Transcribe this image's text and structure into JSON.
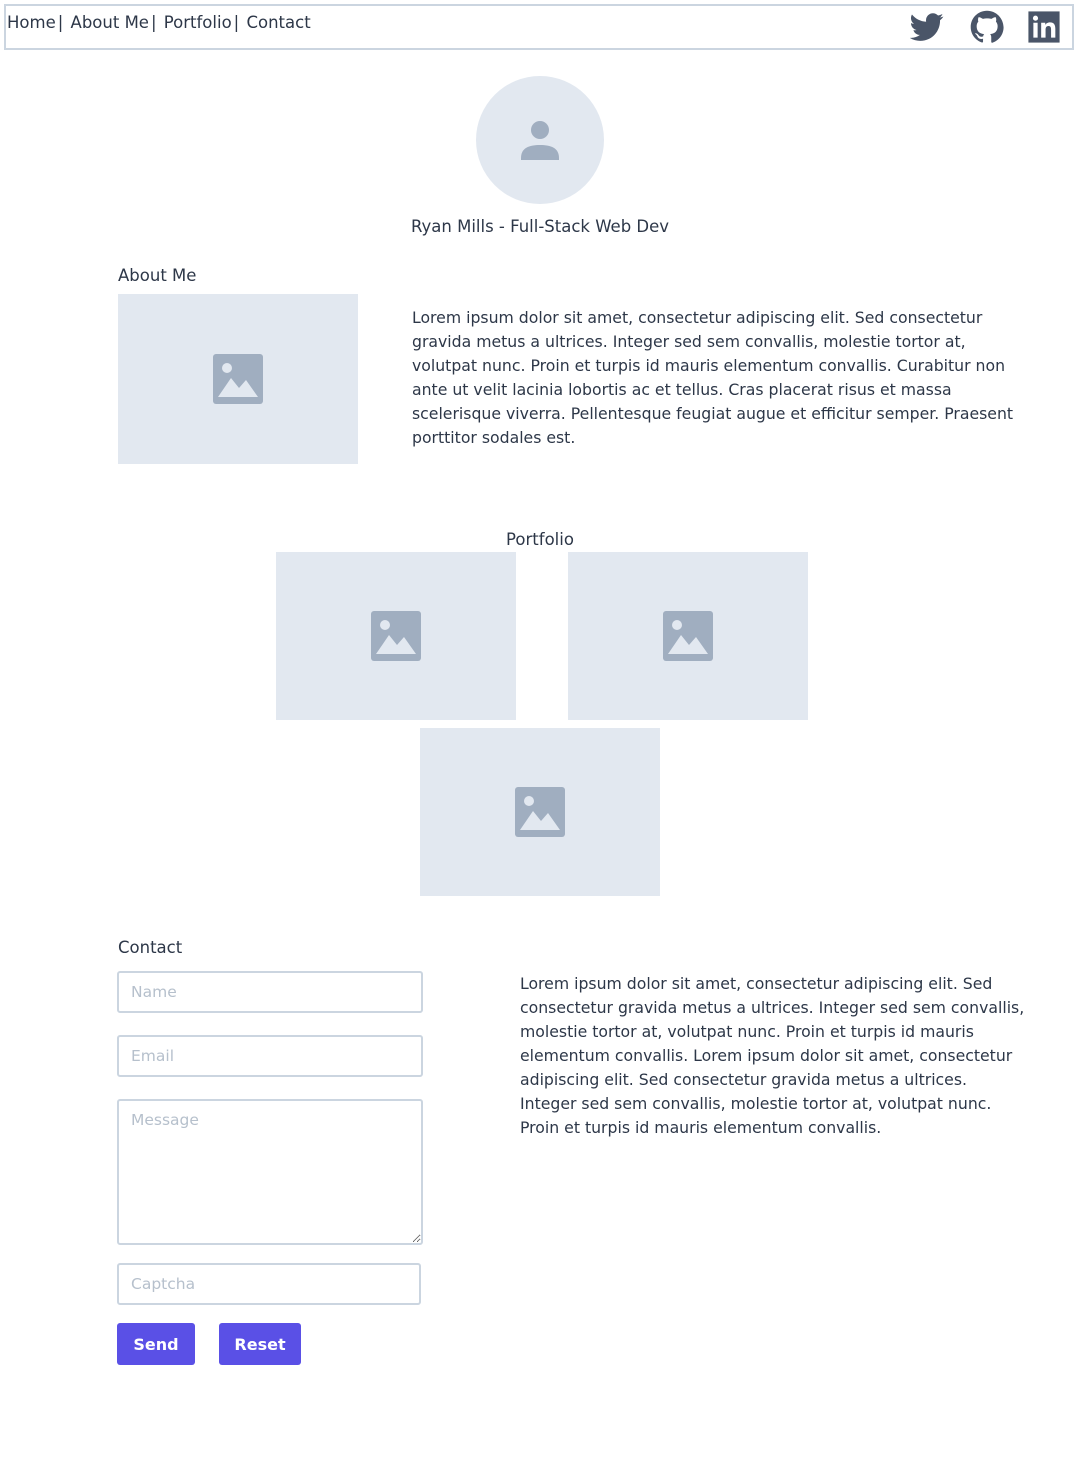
{
  "nav": {
    "links": [
      "Home",
      "About Me",
      "Portfolio",
      "Contact"
    ],
    "separator": "|",
    "social_icons": [
      "twitter-icon",
      "github-icon",
      "linkedin-icon"
    ]
  },
  "profile": {
    "avatar_icon": "user-icon",
    "title": "Ryan Mills - Full-Stack Web Dev"
  },
  "about": {
    "heading": "About Me",
    "image_icon": "image-icon",
    "text": "Lorem ipsum dolor sit amet, consectetur adipiscing elit. Sed consectetur gravida metus a ultrices. Integer sed sem convallis, molestie tortor at, volutpat nunc. Proin et turpis id mauris elementum convallis. Curabitur non ante ut velit lacinia lobortis ac et tellus. Cras placerat risus et massa scelerisque viverra. Pellentesque feugiat augue et efficitur semper. Praesent porttitor sodales est."
  },
  "portfolio": {
    "heading": "Portfolio",
    "items": [
      "image-icon",
      "image-icon",
      "image-icon"
    ]
  },
  "contact": {
    "heading": "Contact",
    "name_placeholder": "Name",
    "email_placeholder": "Email",
    "message_placeholder": "Message",
    "captcha_placeholder": "Captcha",
    "send_label": "Send",
    "reset_label": "Reset",
    "text": "Lorem ipsum dolor sit amet, consectetur adipiscing elit. Sed consectetur gravida metus a ultrices. Integer sed sem convallis, molestie tortor at, volutpat nunc. Proin et turpis id mauris elementum convallis. Lorem ipsum dolor sit amet, consectetur adipiscing elit. Sed consectetur gravida metus a ultrices. Integer sed sem convallis, molestie tortor at, volutpat nunc. Proin et turpis id mauris elementum convallis."
  },
  "colors": {
    "accent": "#5a50e6",
    "placeholder_bg": "#e2e8f0",
    "icon_gray": "#a0aec0",
    "social_icon": "#4a5568",
    "border": "#cbd5e0"
  }
}
